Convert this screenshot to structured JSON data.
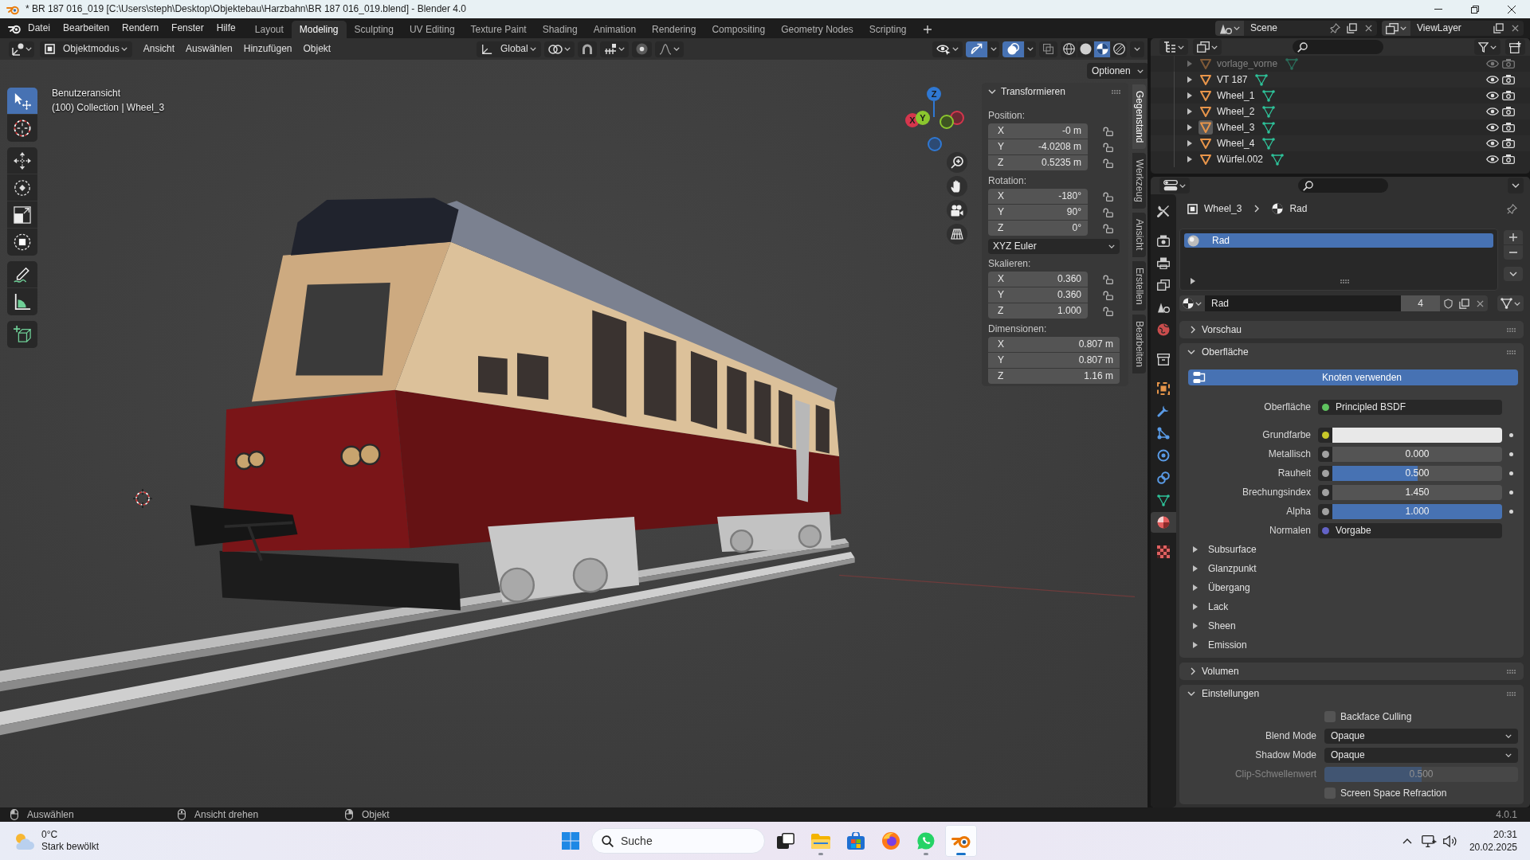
{
  "window": {
    "title": "* BR 187 016_019 [C:\\Users\\steph\\Desktop\\Objektebau\\Harzbahn\\BR 187 016_019.blend] - Blender 4.0"
  },
  "menu": [
    "Datei",
    "Bearbeiten",
    "Rendern",
    "Fenster",
    "Hilfe"
  ],
  "workspaces": [
    {
      "label": "Layout",
      "selected": false
    },
    {
      "label": "Modeling",
      "selected": true
    },
    {
      "label": "Sculpting",
      "selected": false
    },
    {
      "label": "UV Editing",
      "selected": false
    },
    {
      "label": "Texture Paint",
      "selected": false
    },
    {
      "label": "Shading",
      "selected": false
    },
    {
      "label": "Animation",
      "selected": false
    },
    {
      "label": "Rendering",
      "selected": false
    },
    {
      "label": "Compositing",
      "selected": false
    },
    {
      "label": "Geometry Nodes",
      "selected": false
    },
    {
      "label": "Scripting",
      "selected": false
    }
  ],
  "scene": "Scene",
  "view_layer": "ViewLayer",
  "viewport": {
    "mode": "Objektmodus",
    "menus": [
      "Ansicht",
      "Auswählen",
      "Hinzufügen",
      "Objekt"
    ],
    "orientation": "Global",
    "gizmos_on": true,
    "overlays_on": true,
    "shading_modes": [
      {
        "kind": "wireframe",
        "selected": false
      },
      {
        "kind": "solid",
        "selected": false
      },
      {
        "kind": "material",
        "selected": true
      },
      {
        "kind": "rendered",
        "selected": false
      }
    ],
    "view_name": "Benutzeransicht",
    "context": "(100) Collection | Wheel_3",
    "options": "Optionen",
    "gizmo_axes": [
      "X",
      "Y",
      "Z"
    ],
    "tool_groups": [
      {
        "tools": [
          {
            "kind": "select",
            "selected": true
          },
          {
            "kind": "cursor",
            "selected": false
          }
        ]
      },
      {
        "tools": [
          {
            "kind": "move",
            "selected": false
          },
          {
            "kind": "rotate",
            "selected": false
          },
          {
            "kind": "scale",
            "selected": false
          },
          {
            "kind": "transform",
            "selected": false
          }
        ]
      },
      {
        "tools": [
          {
            "kind": "annotate",
            "selected": false
          },
          {
            "kind": "measure",
            "selected": false
          }
        ]
      },
      {
        "tools": [
          {
            "kind": "add-cube",
            "selected": false
          }
        ]
      }
    ]
  },
  "sidebar": {
    "tabs": [
      {
        "label": "Gegenstand",
        "selected": true
      },
      {
        "label": "Werkzeug",
        "selected": false
      },
      {
        "label": "Ansicht",
        "selected": false
      },
      {
        "label": "Erstellen",
        "selected": false
      },
      {
        "label": "Bearbeiten",
        "selected": false
      }
    ],
    "panel": {
      "title": "Transformieren",
      "expanded": true,
      "groups": [
        {
          "label": "Position:",
          "lockable": true,
          "fields": [
            {
              "axis": "X",
              "value": "-0 m"
            },
            {
              "axis": "Y",
              "value": "-4.0208 m"
            },
            {
              "axis": "Z",
              "value": "0.5235 m"
            }
          ]
        },
        {
          "label": "Rotation:",
          "lockable": true,
          "fields": [
            {
              "axis": "X",
              "value": "-180°"
            },
            {
              "axis": "Y",
              "value": "90°"
            },
            {
              "axis": "Z",
              "value": "0°"
            }
          ],
          "mode": "XYZ Euler"
        },
        {
          "label": "Skalieren:",
          "lockable": true,
          "fields": [
            {
              "axis": "X",
              "value": "0.360"
            },
            {
              "axis": "Y",
              "value": "0.360"
            },
            {
              "axis": "Z",
              "value": "1.000"
            }
          ]
        },
        {
          "label": "Dimensionen:",
          "lockable": false,
          "fields": [
            {
              "axis": "X",
              "value": "0.807 m"
            },
            {
              "axis": "Y",
              "value": "0.807 m"
            },
            {
              "axis": "Z",
              "value": "1.16 m"
            }
          ]
        }
      ]
    }
  },
  "outliner": {
    "rows": [
      {
        "name": "vorlage_vorne",
        "expanded": false,
        "selected": false,
        "disabled": true
      },
      {
        "name": "VT 187",
        "expanded": false,
        "selected": false,
        "disabled": false
      },
      {
        "name": "Wheel_1",
        "expanded": false,
        "selected": false,
        "disabled": false
      },
      {
        "name": "Wheel_2",
        "expanded": false,
        "selected": false,
        "disabled": false
      },
      {
        "name": "Wheel_3",
        "expanded": false,
        "selected": true,
        "disabled": false
      },
      {
        "name": "Wheel_4",
        "expanded": false,
        "selected": false,
        "disabled": false
      },
      {
        "name": "Würfel.002",
        "expanded": false,
        "selected": false,
        "disabled": false
      }
    ]
  },
  "properties": {
    "tabs": [
      {
        "kind": "tool",
        "selected": false
      },
      {
        "kind": "render",
        "selected": false
      },
      {
        "kind": "output",
        "selected": false
      },
      {
        "kind": "view-layer",
        "selected": false
      },
      {
        "kind": "scene",
        "selected": false
      },
      {
        "kind": "world",
        "selected": false
      },
      {
        "kind": "collection",
        "selected": false
      },
      {
        "kind": "object",
        "selected": false
      },
      {
        "kind": "modifiers",
        "selected": false
      },
      {
        "kind": "particles",
        "selected": false
      },
      {
        "kind": "physics",
        "selected": false
      },
      {
        "kind": "constraints",
        "selected": false
      },
      {
        "kind": "data",
        "selected": false
      },
      {
        "kind": "material",
        "selected": true
      },
      {
        "kind": "texture",
        "selected": false
      }
    ],
    "breadcrumb": {
      "object": "Wheel_3",
      "material": "Rad"
    },
    "slots": [
      {
        "name": "Rad",
        "selected": true
      }
    ],
    "material": {
      "name": "Rad",
      "users": "4"
    },
    "panels": [
      {
        "title": "Vorschau",
        "expanded": false
      },
      {
        "kind": "surface",
        "title": "Oberfläche",
        "expanded": true,
        "button": "Knoten verwenden",
        "shader": {
          "label": "Oberfläche",
          "value": "Principled BSDF",
          "color": "#5fc35f"
        },
        "inputs": [
          {
            "kind": "color",
            "label": "Grundfarbe",
            "color": "#c7c729",
            "swatch": {
              "color": "#e8e8e8"
            }
          },
          {
            "kind": "slider",
            "label": "Metallisch",
            "color": "#a1a1a1",
            "value": "0.000",
            "level": 0
          },
          {
            "kind": "slider",
            "label": "Rauheit",
            "color": "#a1a1a1",
            "value": "0.500",
            "level": 0.5
          },
          {
            "kind": "number",
            "label": "Brechungsindex",
            "color": "#a1a1a1",
            "value": "1.450"
          },
          {
            "kind": "slider",
            "label": "Alpha",
            "color": "#a1a1a1",
            "value": "1.000",
            "level": 1
          },
          {
            "kind": "link",
            "label": "Normalen",
            "color": "#6363c7",
            "value": "Vorgabe"
          }
        ],
        "subpanels": [
          {
            "title": "Subsurface",
            "expanded": false
          },
          {
            "title": "Glanzpunkt",
            "expanded": false
          },
          {
            "title": "Übergang",
            "expanded": false
          },
          {
            "title": "Lack",
            "expanded": false
          },
          {
            "title": "Sheen",
            "expanded": false
          },
          {
            "title": "Emission",
            "expanded": false
          }
        ]
      },
      {
        "title": "Volumen",
        "expanded": false
      },
      {
        "kind": "settings",
        "title": "Einstellungen",
        "expanded": true,
        "settings": [
          {
            "kind": "checkbox",
            "label": "Backface Culling",
            "checked": false,
            "disabled": false
          },
          {
            "kind": "dropdown",
            "label": "Blend Mode",
            "value": "Opaque",
            "disabled": false
          },
          {
            "kind": "dropdown",
            "label": "Shadow Mode",
            "value": "Opaque",
            "disabled": false
          },
          {
            "kind": "slider",
            "label": "Clip-Schwellenwert",
            "value": "0.500",
            "level": 0.5,
            "disabled": true
          },
          {
            "kind": "checkbox",
            "label": "Screen Space Refraction",
            "checked": false,
            "disabled": false
          }
        ]
      }
    ]
  },
  "status_bar": {
    "hints": [
      {
        "kind": "left-click",
        "label": "Auswählen"
      },
      {
        "kind": "middle-click",
        "label": "Ansicht drehen"
      },
      {
        "kind": "right-click",
        "label": "Objekt"
      }
    ],
    "version": "4.0.1"
  },
  "taskbar": {
    "weather": {
      "temperature": "0°C",
      "condition": "Stark bewölkt"
    },
    "search": {
      "placeholder": "Suche"
    },
    "apps": [
      {
        "kind": "task-view",
        "running": false,
        "selected": false
      },
      {
        "kind": "files",
        "running": true,
        "selected": false
      },
      {
        "kind": "store",
        "running": false,
        "selected": false
      },
      {
        "kind": "browser",
        "running": false,
        "selected": false
      },
      {
        "kind": "chat",
        "running": true,
        "selected": false
      },
      {
        "kind": "blender",
        "running": true,
        "selected": true
      }
    ],
    "time": "20:31",
    "date": "20.02.2025"
  }
}
